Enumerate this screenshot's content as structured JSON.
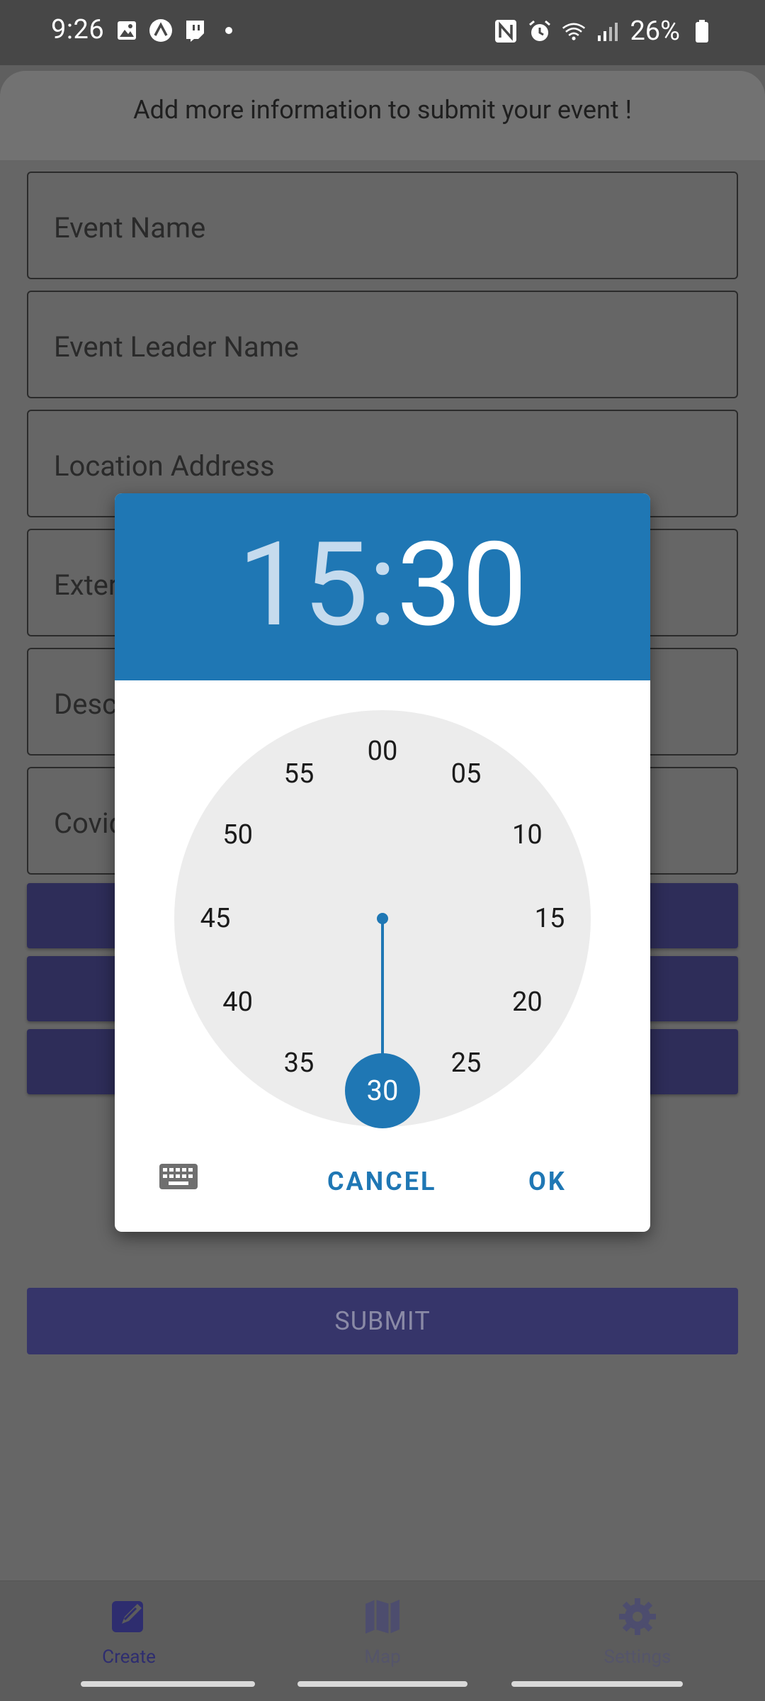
{
  "status_bar": {
    "time": "9:26",
    "battery": "26%",
    "icons_left": [
      "image-icon",
      "app-icon",
      "twitch-icon"
    ],
    "icons_right": [
      "nfc-icon",
      "alarm-icon",
      "wifi-icon",
      "signal-icon",
      "battery-icon"
    ]
  },
  "header": {
    "text": "Add more information to submit your event !"
  },
  "form": {
    "fields": [
      {
        "label": "Event Name"
      },
      {
        "label": "Event Leader Name"
      },
      {
        "label": "Location Address"
      },
      {
        "label": "Exter"
      },
      {
        "label": "Desc"
      },
      {
        "label": "Covid"
      }
    ],
    "submit_label": "SUBMIT"
  },
  "time_picker": {
    "hour": "15",
    "separator": ":",
    "minute": "30",
    "minute_labels": [
      "00",
      "05",
      "10",
      "15",
      "20",
      "25",
      "30",
      "35",
      "40",
      "45",
      "50",
      "55"
    ],
    "selected_minute": "30",
    "cancel_label": "CANCEL",
    "ok_label": "OK"
  },
  "bottom_nav": {
    "items": [
      {
        "label": "Create",
        "icon": "pencil-icon",
        "active": true
      },
      {
        "label": "Map",
        "icon": "map-icon",
        "active": false
      },
      {
        "label": "Settings",
        "icon": "gear-icon",
        "active": false
      }
    ]
  },
  "colors": {
    "accent": "#1f77b4",
    "purple": "#2e2d59",
    "scrim": "#666666"
  }
}
